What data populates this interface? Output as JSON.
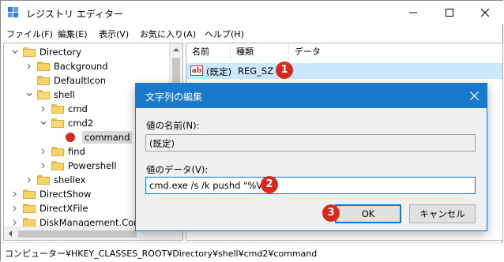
{
  "window": {
    "title": "レジストリ エディター"
  },
  "menu": [
    "ファイル(F)",
    "編集(E)",
    "表示(V)",
    "お気に入り(A)",
    "ヘルプ(H)"
  ],
  "tree": {
    "items": [
      {
        "label": "Directory",
        "expanded": true
      },
      {
        "label": "Background",
        "expanded": false
      },
      {
        "label": "DefaultIcon",
        "expanded": false
      },
      {
        "label": "shell",
        "expanded": true
      },
      {
        "label": "cmd",
        "expanded": false
      },
      {
        "label": "cmd2",
        "expanded": true
      },
      {
        "label": "command",
        "selected": true
      },
      {
        "label": "find",
        "expanded": false
      },
      {
        "label": "Powershell",
        "expanded": false
      },
      {
        "label": "shellex",
        "expanded": false
      },
      {
        "label": "DirectShow",
        "expanded": false
      },
      {
        "label": "DirectXFile",
        "expanded": false
      },
      {
        "label": "DiskManagement.Conn",
        "expanded": false
      }
    ]
  },
  "values_pane": {
    "columns": [
      "名前",
      "種類",
      "データ"
    ],
    "rows": [
      {
        "name": "(既定)",
        "type": "REG_SZ",
        "data": ""
      }
    ]
  },
  "dialog": {
    "title": "文字列の編集",
    "name_label": "値の名前(N):",
    "name_value": "(既定)",
    "data_label": "値のデータ(V):",
    "data_value": "cmd.exe /s /k pushd \"%V\"",
    "ok_label": "OK",
    "cancel_label": "キャンセル"
  },
  "badges": [
    "1",
    "2",
    "3"
  ],
  "statusbar": {
    "path": "コンピューター¥HKEY_CLASSES_ROOT¥Directory¥shell¥cmd2¥command"
  },
  "colors": {
    "accent": "#1979ca",
    "selection": "#cce8ff",
    "badge": "#d62a1c",
    "folder": "#f6d365"
  },
  "icons": [
    "regedit-icon",
    "minimize-icon",
    "maximize-icon",
    "close-icon",
    "folder-icon",
    "chevron-right-icon",
    "chevron-down-icon",
    "string-value-icon",
    "record-dot-icon"
  ]
}
